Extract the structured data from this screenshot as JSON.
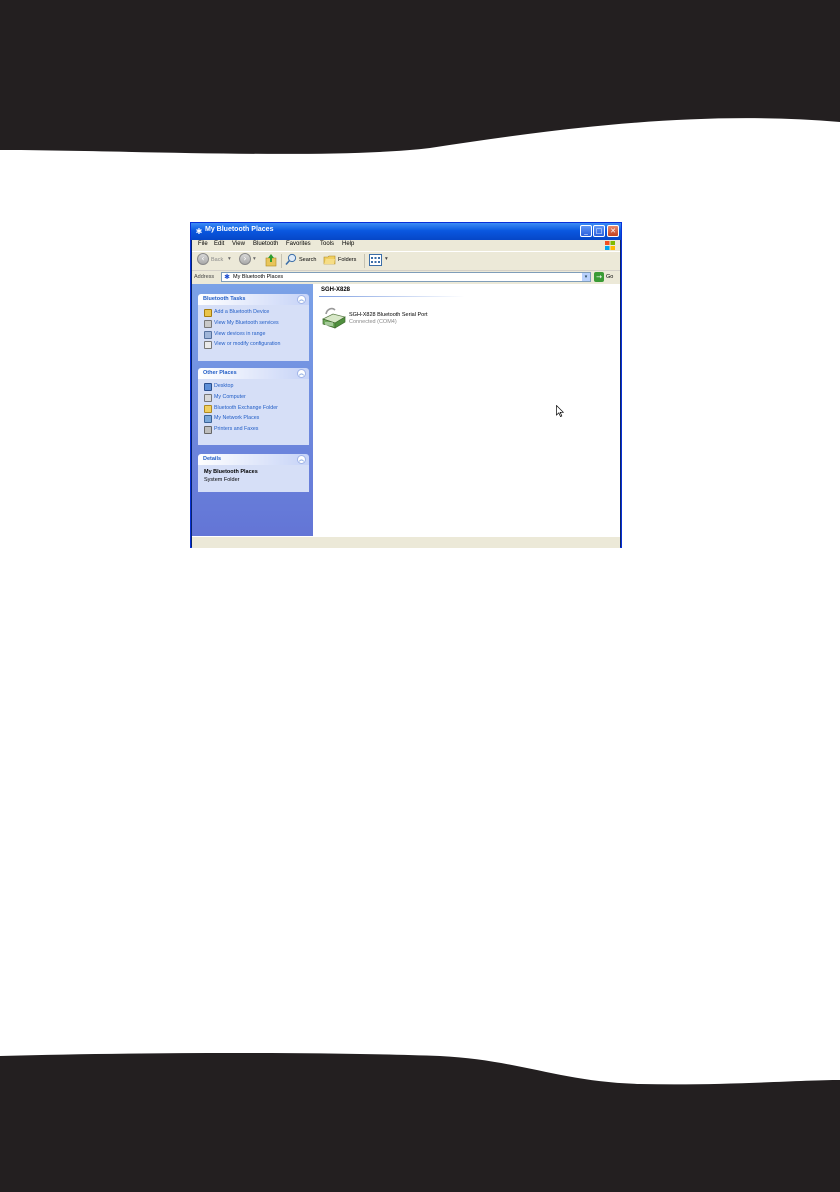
{
  "window": {
    "title": "My Bluetooth Places",
    "buttons": {
      "minimize": "_",
      "maximize": "□",
      "close": "✕"
    }
  },
  "menu": [
    "File",
    "Edit",
    "View",
    "Bluetooth",
    "Favorites",
    "Tools",
    "Help"
  ],
  "toolbar": {
    "back": "Back",
    "search": "Search",
    "folders": "Folders"
  },
  "address": {
    "label": "Address",
    "value": "My Bluetooth Places",
    "go": "Go"
  },
  "tasks": {
    "title": "Bluetooth Tasks",
    "items": [
      {
        "label": "Add a Bluetooth Device",
        "icon": "add-device-icon"
      },
      {
        "label": "View My Bluetooth services",
        "icon": "services-icon"
      },
      {
        "label": "View devices in range",
        "icon": "devices-in-range-icon"
      },
      {
        "label": "View or modify configuration",
        "icon": "configuration-icon"
      }
    ]
  },
  "other_places": {
    "title": "Other Places",
    "items": [
      {
        "label": "Desktop",
        "icon": "desktop-icon"
      },
      {
        "label": "My Computer",
        "icon": "my-computer-icon"
      },
      {
        "label": "Bluetooth Exchange Folder",
        "icon": "folder-icon"
      },
      {
        "label": "My Network Places",
        "icon": "network-places-icon"
      },
      {
        "label": "Printers and Faxes",
        "icon": "printer-icon"
      }
    ]
  },
  "details": {
    "title": "Details",
    "name": "My Bluetooth Places",
    "type": "System Folder"
  },
  "content": {
    "group": "SGH-X828",
    "item_name": "SGH-X828 Bluetooth Serial Port",
    "item_status": "Connected (COM4)"
  },
  "colors": {
    "title_bar": "#0a58e0",
    "task_pane": "#6f8fdf",
    "link": "#215dc6",
    "page_band": "#231f20"
  }
}
